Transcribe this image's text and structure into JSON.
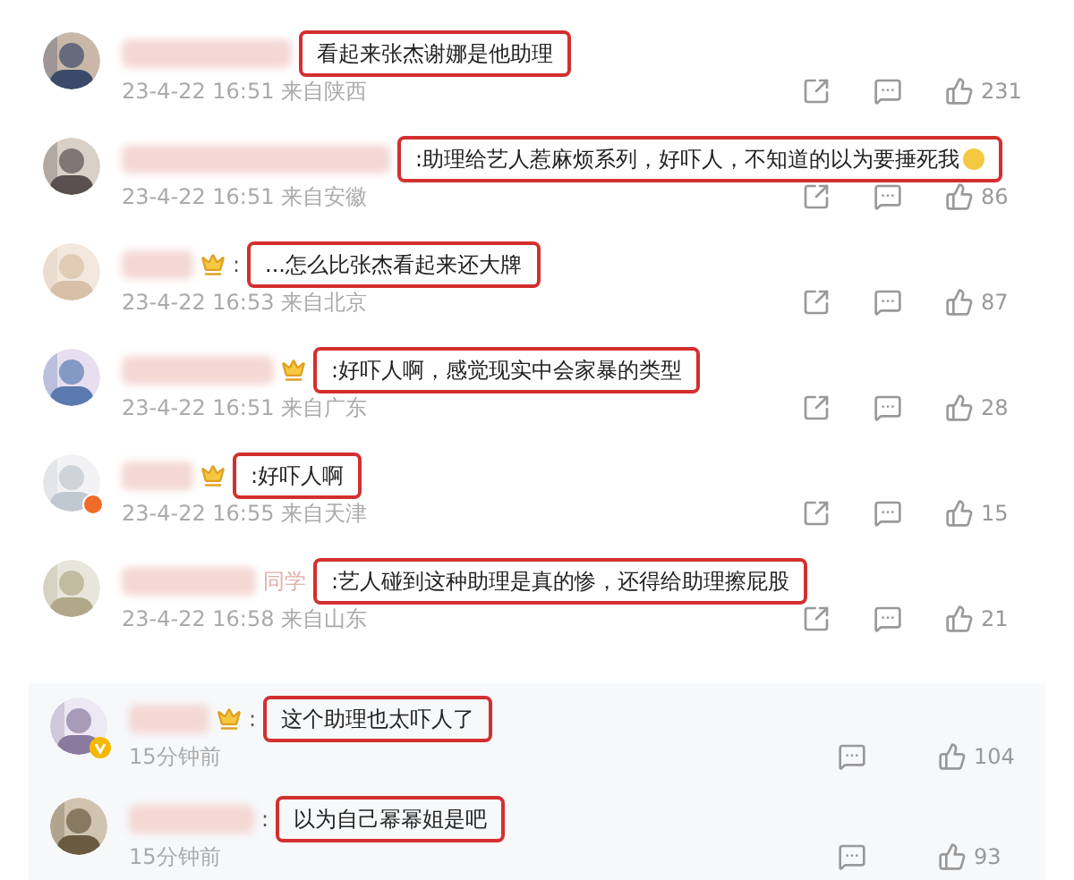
{
  "comments": [
    {
      "vip_badge": false,
      "text": "看起来张杰谢娜是他助理",
      "meta": "23-4-22 16:51 来自陕西",
      "likes": "231"
    },
    {
      "vip_badge": false,
      "text": ":助理给艺人惹麻烦系列，好吓人，不知道的以为要捶死我",
      "emoji": true,
      "meta": "23-4-22 16:51 来自安徽",
      "likes": "86"
    },
    {
      "vip_badge": true,
      "prefix": ":",
      "text": "...怎么比张杰看起来还大牌",
      "meta": "23-4-22 16:53 来自北京",
      "likes": "87"
    },
    {
      "vip_badge": true,
      "text": ":好吓人啊，感觉现实中会家暴的类型",
      "meta": "23-4-22 16:51 来自广东",
      "likes": "28"
    },
    {
      "vip_badge": true,
      "avatar_badge": {
        "kind": "dot"
      },
      "text": ":好吓人啊",
      "meta": "23-4-22 16:55 来自天津",
      "likes": "15"
    },
    {
      "vip_badge": false,
      "name_visible": "同学",
      "text": ":艺人碰到这种助理是真的惨，还得给助理擦屁股",
      "meta": "23-4-22 16:58 来自山东",
      "likes": "21"
    }
  ],
  "replies": [
    {
      "vip_badge": true,
      "avatar_badge": {
        "kind": "v"
      },
      "prefix": ":",
      "text": "这个助理也太吓人了",
      "meta": "15分钟前",
      "likes": "104"
    },
    {
      "vip_badge": false,
      "prefix": ":",
      "text": "以为自己幂幂姐是吧",
      "meta": "15分钟前",
      "likes": "93"
    }
  ]
}
